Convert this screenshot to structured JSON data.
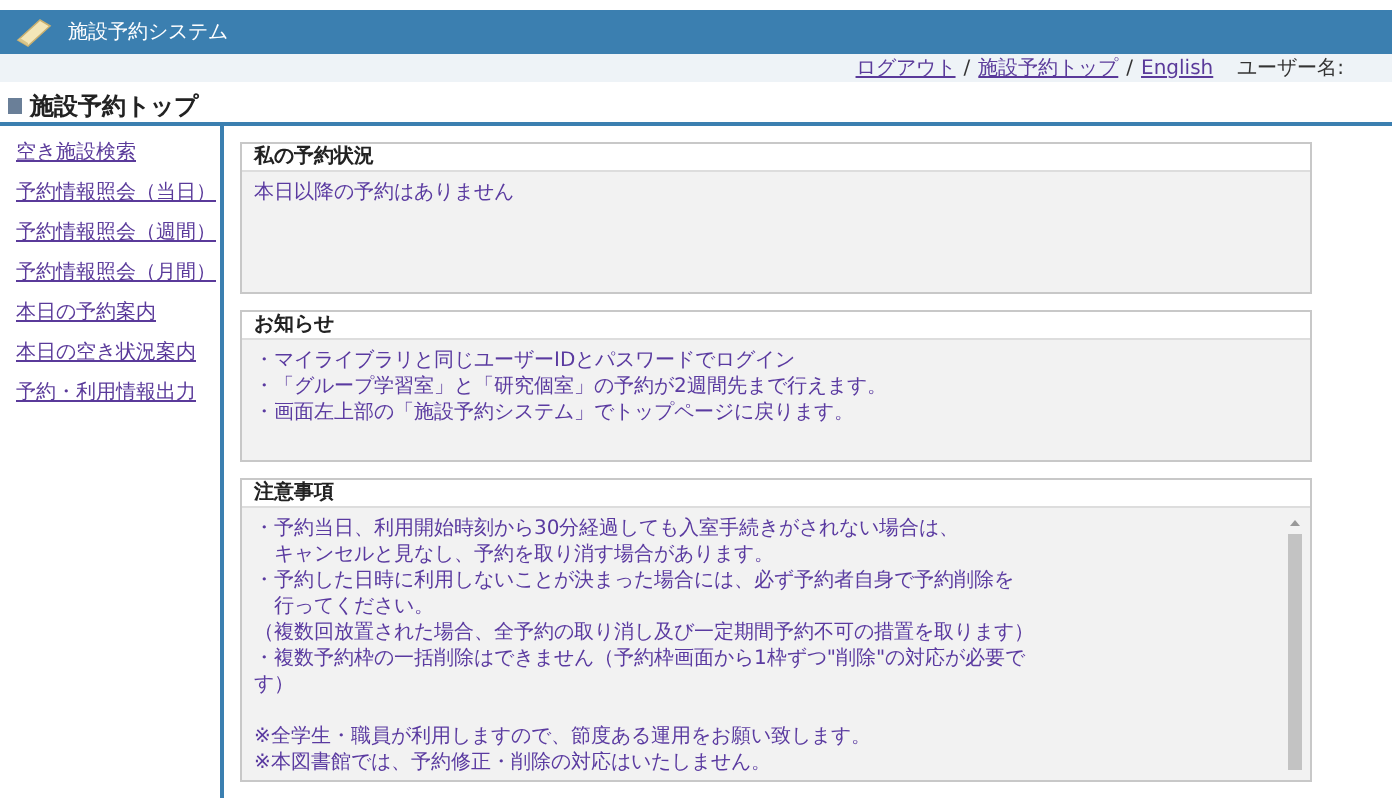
{
  "header": {
    "title": "施設予約システム"
  },
  "top_links": [
    {
      "label": "ログアウト"
    },
    {
      "label": "施設予約トップ"
    },
    {
      "label": "English"
    }
  ],
  "top_separator": "/",
  "user_label": "ユーザー名:",
  "page_title": "施設予約トップ",
  "sidebar": {
    "items": [
      {
        "label": "空き施設検索"
      },
      {
        "label": "予約情報照会（当日）"
      },
      {
        "label": "予約情報照会（週間）"
      },
      {
        "label": "予約情報照会（月間）"
      },
      {
        "label": "本日の予約案内"
      },
      {
        "label": "本日の空き状況案内"
      },
      {
        "label": "予約・利用情報出力"
      }
    ]
  },
  "panels": [
    {
      "title": "私の予約状況",
      "groups": [
        [
          {
            "text": "本日以降の予約はありません",
            "indented": false
          }
        ]
      ]
    },
    {
      "title": "お知らせ",
      "groups": [
        [
          {
            "text": "・マイライブラリと同じユーザーIDとパスワードでログイン",
            "indented": false
          },
          {
            "text": "・「グループ学習室」と「研究個室」の予約が2週間先まで行えます。",
            "indented": false
          },
          {
            "text": "・画面左上部の「施設予約システム」でトップページに戻ります。",
            "indented": false
          }
        ]
      ]
    },
    {
      "title": "注意事項",
      "scrollable": true,
      "groups": [
        [
          {
            "text": "・予約当日、利用開始時刻から30分経過しても入室手続きがされない場合は、",
            "indented": false
          },
          {
            "text": "キャンセルと見なし、予約を取り消す場合があります。",
            "indented": true
          },
          {
            "text": "・予約した日時に利用しないことが決まった場合には、必ず予約者自身で予約削除を",
            "indented": false
          },
          {
            "text": "行ってください。",
            "indented": true
          },
          {
            "text": "（複数回放置された場合、全予約の取り消し及び一定期間予約不可の措置を取ります）",
            "indented": false
          },
          {
            "text": "・複数予約枠の一括削除はできません（予約枠画面から1枠ずつ\"削除\"の対応が必要で",
            "indented": false
          },
          {
            "text": "す）",
            "indented": false
          }
        ],
        [
          {
            "text": "※全学生・職員が利用しますので、節度ある運用をお願い致します。",
            "indented": false
          },
          {
            "text": "※本図書館では、予約修正・削除の対応はいたしません。",
            "indented": false
          }
        ]
      ]
    }
  ]
}
